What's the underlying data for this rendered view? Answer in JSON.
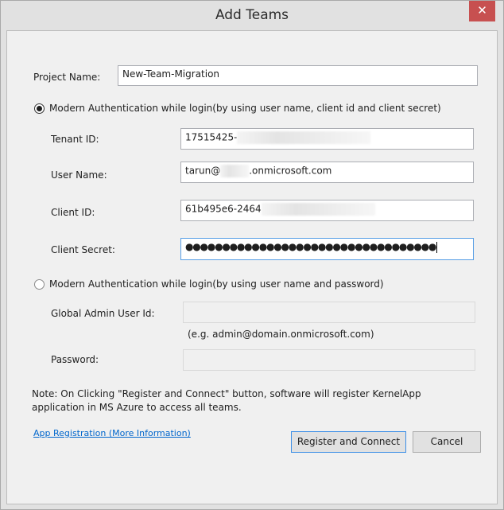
{
  "window": {
    "title": "Add Teams",
    "close_glyph": "✕"
  },
  "project": {
    "label": "Project Name:",
    "value": "New-Team-Migration"
  },
  "option_client_secret": {
    "label": "Modern Authentication while login(by using user name, client id and client secret)",
    "selected": true,
    "tenant_id": {
      "label": "Tenant ID:",
      "value_visible": "17515425-"
    },
    "user_name": {
      "label": "User Name:",
      "value_prefix": "tarun@",
      "value_suffix": ".onmicrosoft.com"
    },
    "client_id": {
      "label": "Client ID:",
      "value_visible": "61b495e6-2464"
    },
    "client_secret": {
      "label": "Client Secret:",
      "masked_value": "●●●●●●●●●●●●●●●●●●●●●●●●●●●●●●●●●●"
    }
  },
  "option_password": {
    "label": "Modern Authentication while login(by using user name and password)",
    "selected": false,
    "admin_user": {
      "label": "Global Admin User Id:",
      "value": "",
      "hint": "(e.g. admin@domain.onmicrosoft.com)"
    },
    "password": {
      "label": "Password:",
      "value": ""
    }
  },
  "note": {
    "line1": "Note: On Clicking \"Register and Connect\" button, software will register KernelApp",
    "line2": "application in MS Azure to access all teams."
  },
  "links": {
    "app_registration": "App Registration (More Information)"
  },
  "buttons": {
    "register": "Register and Connect",
    "cancel": "Cancel"
  }
}
